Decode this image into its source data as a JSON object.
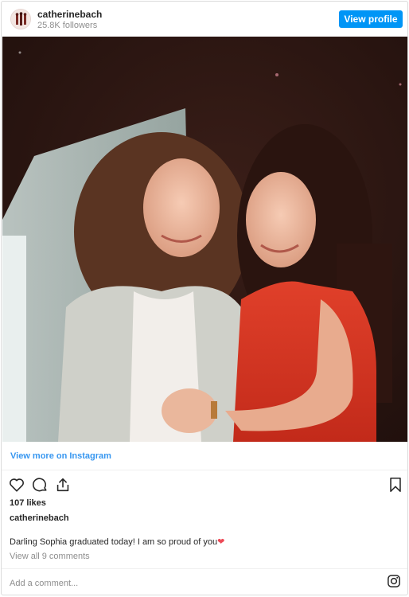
{
  "header": {
    "username": "catherinebach",
    "followers": "25.8K followers",
    "view_profile_label": "View profile"
  },
  "post": {
    "image_alt": "Two women smiling and holding hands",
    "view_more_label": "View more on Instagram",
    "likes": "107 likes",
    "caption_user": "catherinebach",
    "caption_text": "Darling Sophia graduated today! I am so proud of you",
    "caption_emoji": "❤",
    "view_comments": "View all 9 comments"
  },
  "comment": {
    "placeholder": "Add a comment..."
  },
  "colors": {
    "accent": "#0095f6",
    "link": "#3897f0",
    "heart": "#ed4956"
  },
  "icons": {
    "like": "heart-outline-icon",
    "comment": "comment-bubble-icon",
    "share": "share-icon",
    "save": "bookmark-icon",
    "brand": "instagram-icon"
  }
}
